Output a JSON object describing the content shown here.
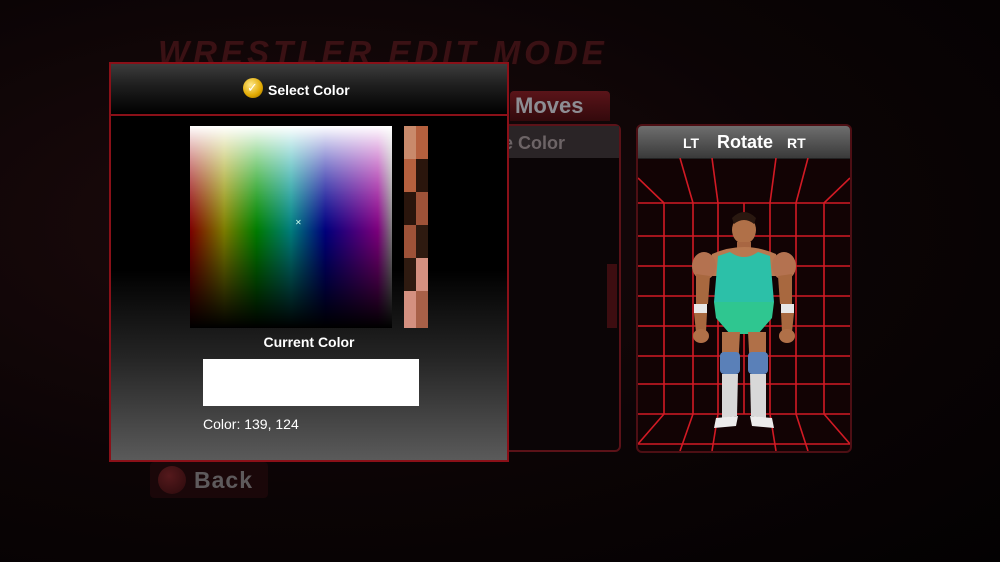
{
  "screen": {
    "title": "WRESTLER EDIT MODE",
    "tab_moves": "Moves",
    "under_panel_header": "e Color",
    "back_label": "Back"
  },
  "viewer": {
    "lt_label": "LT",
    "rotate_label": "Rotate",
    "rt_label": "RT",
    "grid_color": "#d11a24"
  },
  "dialog": {
    "title": "Select Color",
    "title_button_icon": "y-button-icon",
    "current_color_label": "Current Color",
    "current_color_hex": "#ffffff",
    "color_value_text": "Color: 139, 124",
    "border_color": "#8a1018"
  },
  "skin_swatches": [
    "#c98a6b",
    "#b5603e",
    "#2a150c",
    "#9e5238",
    "#2e1a10",
    "#d49080",
    "#a86048"
  ]
}
